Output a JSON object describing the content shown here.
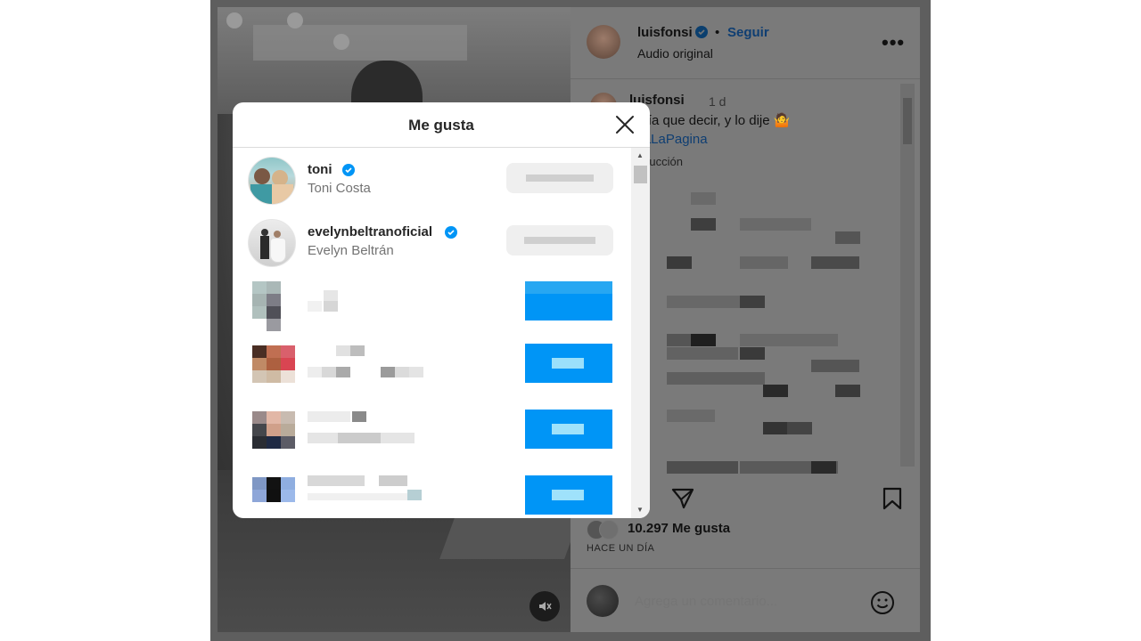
{
  "post": {
    "username": "luisfonsi",
    "separator": "•",
    "follow_label": "Seguir",
    "audio_label": "Audio original",
    "more_label": "•••",
    "caption_user": "luisfonsi",
    "caption_time": "1 d",
    "caption_text": "tenía que decir, y lo dije 🤷",
    "caption_tag": "asaLaPagina",
    "translation_label": "traducción",
    "likes_count": "10.297 Me gusta",
    "time_ago": "HACE UN DÍA",
    "comment_placeholder": "Agrega un comentario..."
  },
  "modal": {
    "title": "Me gusta",
    "rows": [
      {
        "username": "toni",
        "fullname": "Toni Costa",
        "verified": true
      },
      {
        "username": "evelynbeltranoficial",
        "fullname": "Evelyn Beltrán",
        "verified": true
      }
    ]
  },
  "colors": {
    "accent": "#0095f6",
    "verified": "#0095f6",
    "title": "#262626",
    "secondary": "#737373"
  },
  "icons": [
    "close-icon",
    "verified-icon",
    "more-icon",
    "share-icon",
    "bookmark-icon",
    "emoji-icon",
    "mute-icon",
    "scroll-up-icon",
    "scroll-down-icon"
  ]
}
